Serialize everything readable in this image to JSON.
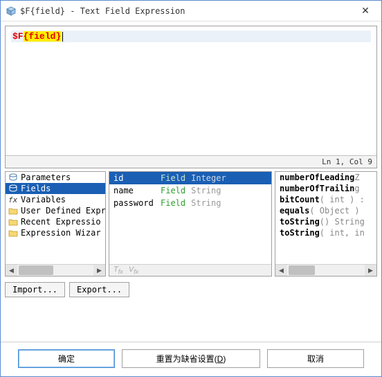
{
  "title": "$F{field} - Text Field Expression",
  "editor": {
    "prefix": "$F",
    "brace_open": "{",
    "token": "field",
    "brace_close": "}"
  },
  "status": "Ln 1, Col 9",
  "tree": [
    {
      "icon": "db",
      "label": "Parameters",
      "selected": false
    },
    {
      "icon": "db",
      "label": "Fields",
      "selected": true
    },
    {
      "icon": "fx",
      "label": "Variables",
      "selected": false
    },
    {
      "icon": "folder",
      "label": "User Defined Expr",
      "selected": false
    },
    {
      "icon": "folder",
      "label": "Recent Expressio",
      "selected": false
    },
    {
      "icon": "folder",
      "label": "Expression Wizar",
      "selected": false
    }
  ],
  "fields": [
    {
      "name": "id",
      "kind": "Field",
      "type": "Integer",
      "selected": true
    },
    {
      "name": "name",
      "kind": "Field",
      "type": "String",
      "selected": false
    },
    {
      "name": "password",
      "kind": "Field",
      "type": "String",
      "selected": false
    }
  ],
  "methods": [
    {
      "bold": "numberOfLeading",
      "grey": "Z"
    },
    {
      "bold": "numberOfTrailin",
      "grey": "g"
    },
    {
      "bold": "bitCount",
      "grey": "( int ) :"
    },
    {
      "bold": "equals",
      "grey": "( Object )"
    },
    {
      "bold": "toString",
      "grey": "() String"
    },
    {
      "bold": "toString",
      "grey": "( int, in"
    }
  ],
  "buttons": {
    "import": "Import...",
    "export": "Export...",
    "ok": "确定",
    "reset_pre": "重置为缺省设置(",
    "reset_u": "D",
    "reset_post": ")",
    "cancel": "取消"
  }
}
